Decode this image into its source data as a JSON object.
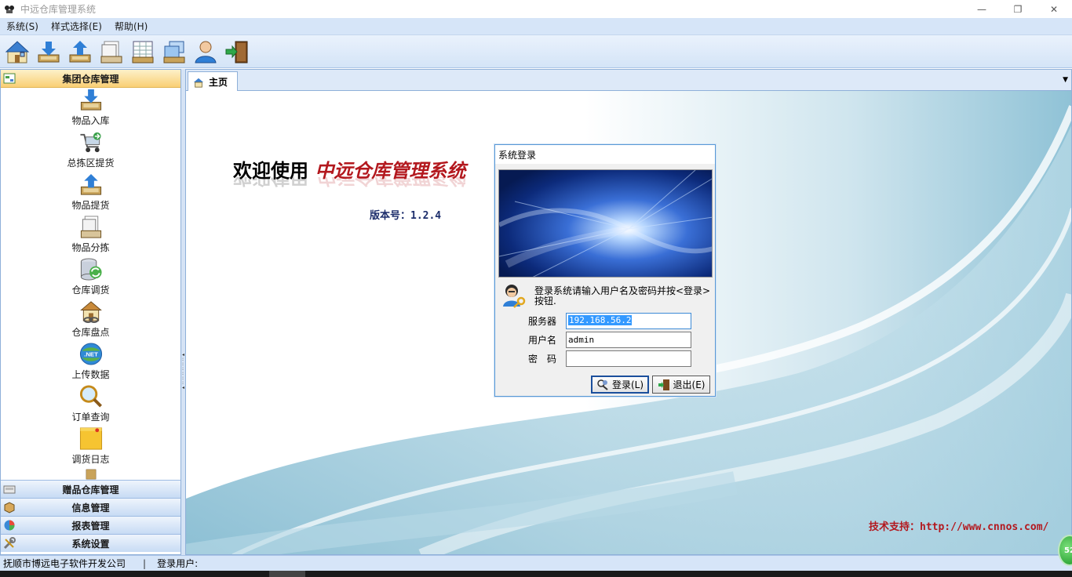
{
  "window": {
    "title": "中远仓库管理系统",
    "controls": [
      "—",
      "❐",
      "✕"
    ]
  },
  "menu": {
    "items": [
      "系统(S)",
      "样式选择(E)",
      "帮助(H)"
    ]
  },
  "toolbar": {
    "buttons": [
      "home-icon",
      "download-icon",
      "upload-icon",
      "documents-icon",
      "spreadsheet-icon",
      "windows-icon",
      "user-icon",
      "exit-door-icon"
    ]
  },
  "leftnav": {
    "active_group": "集团仓库管理",
    "items": [
      {
        "label": "物品入库",
        "icon": "inbox-download-icon"
      },
      {
        "label": "总拣区提货",
        "icon": "cart-icon"
      },
      {
        "label": "物品提货",
        "icon": "inbox-upload-icon"
      },
      {
        "label": "物品分拣",
        "icon": "documents-icon"
      },
      {
        "label": "仓库调货",
        "icon": "database-refresh-icon"
      },
      {
        "label": "仓库盘点",
        "icon": "house-link-icon"
      },
      {
        "label": "上传数据",
        "icon": "dotnet-globe-icon"
      },
      {
        "label": "订单查询",
        "icon": "magnifier-icon"
      },
      {
        "label": "调货日志",
        "icon": "note-icon"
      }
    ],
    "groups": [
      "赠品仓库管理",
      "信息管理",
      "报表管理",
      "系统设置"
    ]
  },
  "main": {
    "tab_label": "主页",
    "welcome_prefix": "欢迎使用",
    "welcome_system": "中远仓库管理系统",
    "version": "版本号：1.2.4",
    "support": "技术支持：http://www.cnnos.com/"
  },
  "login": {
    "title": "系统登录",
    "message": "登录系统请输入用户名及密码并按<登录>按钮.",
    "server_label": "服务器",
    "server_value": "192.168.56.2",
    "username_label": "用户名",
    "username_value": "admin",
    "password_label": "密　码",
    "password_value": "",
    "login_button": "登录(L)",
    "exit_button": "退出(E)"
  },
  "status": {
    "company": "抚顺市博远电子软件开发公司",
    "separator": "|",
    "login_user_label": "登录用户:"
  },
  "bubble_text": "52"
}
